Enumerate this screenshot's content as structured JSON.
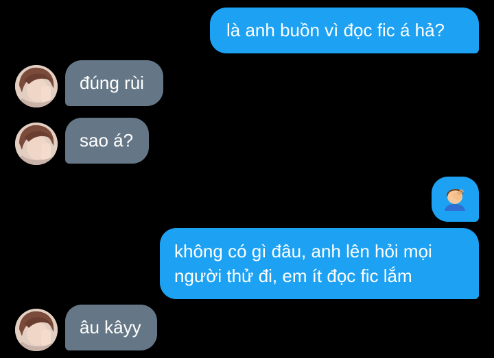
{
  "conversation": {
    "messages": [
      {
        "sender": "me",
        "text": "là anh buồn vì đọc fic á hả?"
      },
      {
        "sender": "them",
        "text": "đúng rùi"
      },
      {
        "sender": "them",
        "text": "sao á?"
      },
      {
        "sender": "me",
        "emoji": "face-palm-emoji"
      },
      {
        "sender": "me",
        "text_lines": [
          "không có gì đâu, anh lên hỏi mọi",
          "người thử đi, em ít đọc fic lắm"
        ]
      },
      {
        "sender": "them",
        "text": "âu kâyy"
      }
    ]
  },
  "colors": {
    "background": "#000000",
    "sent_bubble": "#1da1f2",
    "received_bubble": "#657786",
    "text": "#ffffff"
  }
}
